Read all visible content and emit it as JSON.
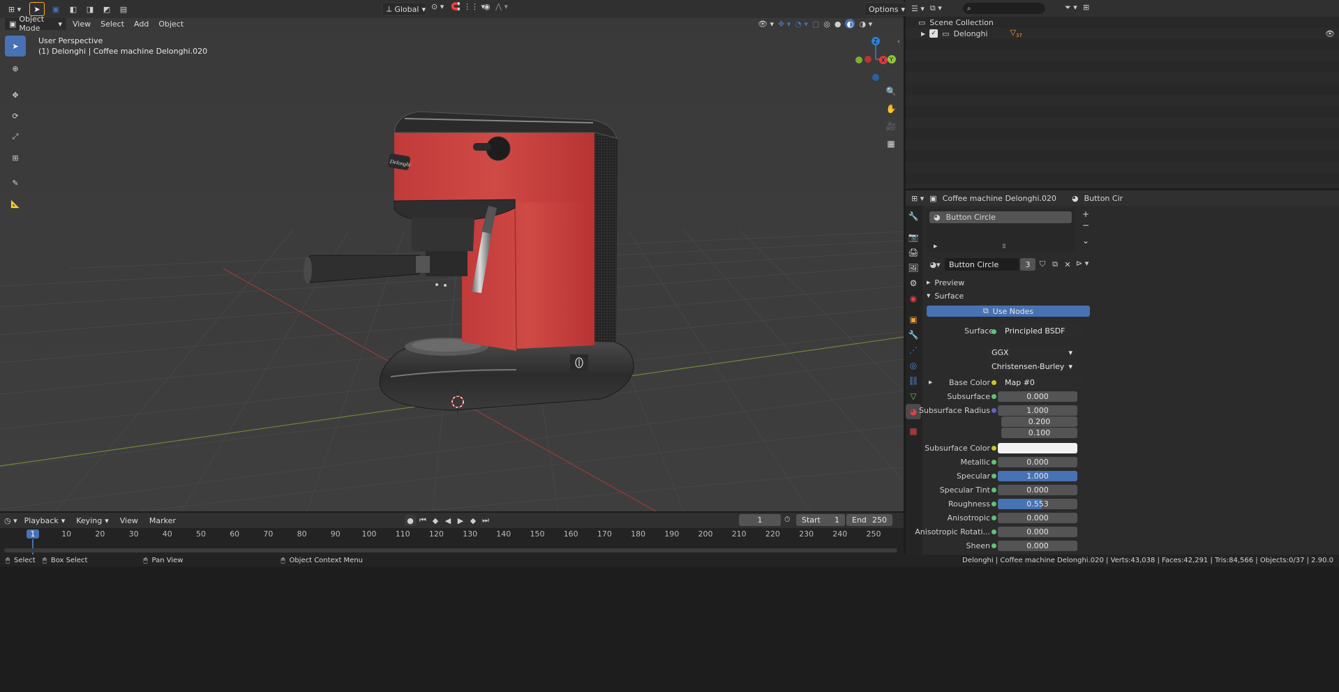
{
  "viewport_header": {
    "mode": "Object Mode",
    "menus": [
      "View",
      "Select",
      "Add",
      "Object"
    ],
    "transform_orientation": "Global",
    "options": "Options"
  },
  "viewport": {
    "perspective": "User Perspective",
    "object_info": "(1) Delonghi | Coffee machine Delonghi.020",
    "gizmo": {
      "z": "Z",
      "y": "Y",
      "x": "X"
    },
    "brand_label": "Delonghi"
  },
  "outliner": {
    "scene_collection": "Scene Collection",
    "collection": "Delonghi",
    "child_count": "37"
  },
  "properties": {
    "object_name": "Coffee machine Delonghi.020",
    "material_tab": "Button Cir",
    "slot_name": "Button Circle",
    "material_name": "Button Circle",
    "user_count": "3",
    "sections": {
      "preview": "Preview",
      "surface": "Surface"
    },
    "use_nodes": "Use Nodes",
    "surface_label": "Surface",
    "surface_value": "Principled BSDF",
    "distribution": "GGX",
    "subsurface_method": "Christensen-Burley",
    "params": [
      {
        "label": "Base Color",
        "value": "Map #0",
        "type": "link",
        "dot": "y"
      },
      {
        "label": "Subsurface",
        "value": "0.000",
        "type": "num",
        "dot": "g"
      },
      {
        "label": "Subsurface Radius",
        "value": "1.000",
        "type": "num",
        "dot": "p"
      },
      {
        "label": "",
        "value": "0.200",
        "type": "num",
        "dot": ""
      },
      {
        "label": "",
        "value": "0.100",
        "type": "num",
        "dot": ""
      },
      {
        "label": "Subsurface Color",
        "value": "",
        "type": "color",
        "dot": "y"
      },
      {
        "label": "Metallic",
        "value": "0.000",
        "type": "num",
        "dot": "g"
      },
      {
        "label": "Specular",
        "value": "1.000",
        "type": "num",
        "dot": "g",
        "fill": 1.0
      },
      {
        "label": "Specular Tint",
        "value": "0.000",
        "type": "num",
        "dot": "g"
      },
      {
        "label": "Roughness",
        "value": "0.553",
        "type": "num",
        "dot": "g",
        "fill": 0.553
      },
      {
        "label": "Anisotropic",
        "value": "0.000",
        "type": "num",
        "dot": "g"
      },
      {
        "label": "Anisotropic Rotati...",
        "value": "0.000",
        "type": "num",
        "dot": "g"
      },
      {
        "label": "Sheen",
        "value": "0.000",
        "type": "num",
        "dot": "g"
      }
    ]
  },
  "timeline": {
    "menus": [
      "Playback",
      "Keying",
      "View",
      "Marker"
    ],
    "current_frame": "1",
    "start_label": "Start",
    "start": "1",
    "end_label": "End",
    "end": "250",
    "ticks": [
      "1",
      "10",
      "20",
      "30",
      "40",
      "50",
      "60",
      "70",
      "80",
      "90",
      "100",
      "110",
      "120",
      "130",
      "140",
      "150",
      "160",
      "170",
      "180",
      "190",
      "200",
      "210",
      "220",
      "230",
      "240",
      "250"
    ]
  },
  "statusbar": {
    "select": "Select",
    "box_select": "Box Select",
    "pan_view": "Pan View",
    "context_menu": "Object Context Menu",
    "stats": "Delonghi | Coffee machine Delonghi.020 | Verts:43,038 | Faces:42,291 | Tris:84,566 | Objects:0/37 | 2.90.0"
  },
  "colors": {
    "accent": "#4772b3",
    "machine_red": "#c43c3c",
    "selected": "#ffaf29"
  }
}
